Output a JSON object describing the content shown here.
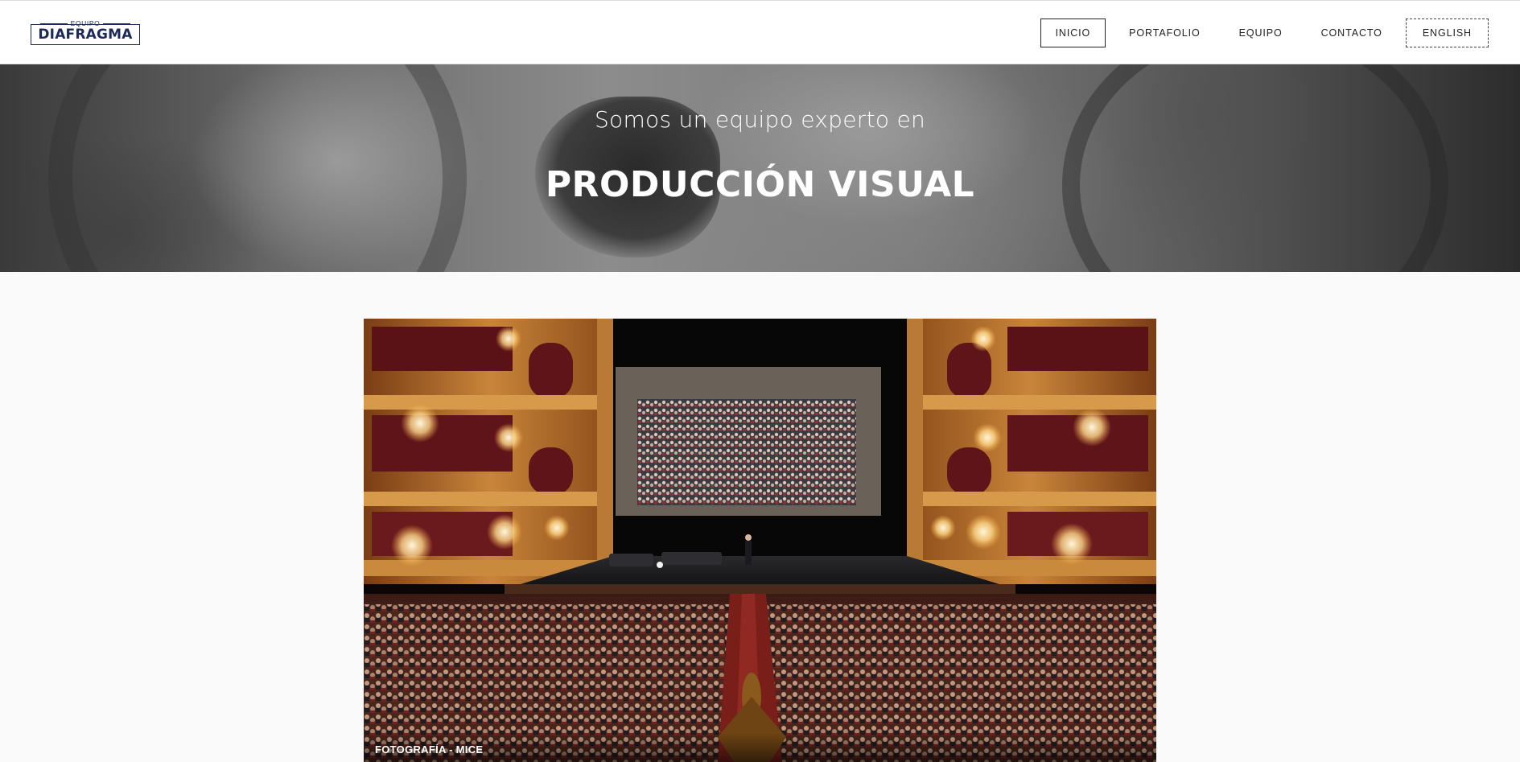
{
  "brand": {
    "small": "EQUIPO",
    "name": "DIAFRAGMA",
    "color": "#1c2a5a"
  },
  "nav": {
    "items": [
      {
        "label": "INICIO",
        "active": true
      },
      {
        "label": "PORTAFOLIO",
        "active": false
      },
      {
        "label": "EQUIPO",
        "active": false
      },
      {
        "label": "CONTACTO",
        "active": false
      }
    ],
    "language": "ENGLISH"
  },
  "hero": {
    "subtitle": "Somos un equipo experto en",
    "title": "PRODUCCIÓN VISUAL"
  },
  "feature": {
    "caption": "FOTOGRAFÍA - MICE"
  }
}
